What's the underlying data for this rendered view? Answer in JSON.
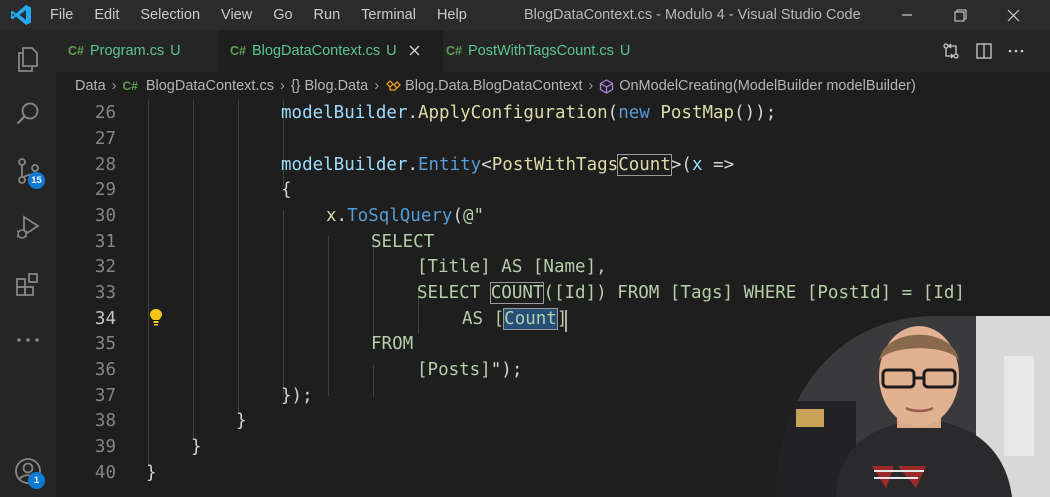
{
  "window": {
    "title": "BlogDataContext.cs - Modulo 4 - Visual Studio Code",
    "menu": [
      "File",
      "Edit",
      "Selection",
      "View",
      "Go",
      "Run",
      "Terminal",
      "Help"
    ]
  },
  "activity_bar": {
    "source_control_badge": "15",
    "accounts_badge": "1",
    "items": [
      "explorer-icon",
      "search-icon",
      "source-control-icon",
      "run-debug-icon",
      "extensions-icon",
      "more-icon",
      "accounts-icon"
    ]
  },
  "tabs": [
    {
      "lang": "C#",
      "name": "Program.cs",
      "status": "U",
      "active": false
    },
    {
      "lang": "C#",
      "name": "BlogDataContext.cs",
      "status": "U",
      "active": true
    },
    {
      "lang": "C#",
      "name": "PostWithTagsCount.cs",
      "status": "U",
      "active": false
    }
  ],
  "breadcrumb": {
    "folder": "Data",
    "lang": "C#",
    "file": "BlogDataContext.cs",
    "namespace_icon": "{}",
    "namespace": "Blog.Data",
    "class": "Blog.Data.BlogDataContext",
    "method": "OnModelCreating(ModelBuilder modelBuilder)"
  },
  "editor": {
    "line_numbers": [
      "26",
      "27",
      "28",
      "29",
      "30",
      "31",
      "32",
      "33",
      "34",
      "35",
      "36",
      "37",
      "38",
      "39",
      "40"
    ],
    "current_line": "34",
    "lines": {
      "l26": {
        "a": "modelBuilder",
        "b": ".",
        "c": "ApplyConfiguration",
        "d": "(",
        "e": "new",
        "f": " ",
        "g": "PostMap",
        "h": "());"
      },
      "l28": {
        "a": "modelBuilder",
        "b": ".",
        "c": "Entity",
        "d": "<",
        "e": "PostWithTags",
        "f": "Count",
        "g": ">(",
        "h": "x",
        "i": " =>"
      },
      "l29": "{",
      "l30": {
        "a": "x",
        "b": ".",
        "c": "ToSqlQuery",
        "d": "(",
        "e": "@\""
      },
      "l31": "SELECT",
      "l32": "[Title] AS [Name],",
      "l33": {
        "a": "SELECT ",
        "b": "COUNT",
        "c": "([Id]) FROM [Tags] WHERE [PostId] = [Id]"
      },
      "l34": {
        "a": "AS [",
        "b": "Count",
        "c": "]"
      },
      "l35": "FROM",
      "l36": {
        "a": "[Posts]",
        "b": "\");"
      },
      "l37": "});",
      "l38": "}",
      "l39": "}",
      "l40": "}"
    }
  },
  "colors": {
    "accent": "#0e7ad3",
    "untracked": "#5bc58f",
    "lightbulb": "#f5c518"
  }
}
